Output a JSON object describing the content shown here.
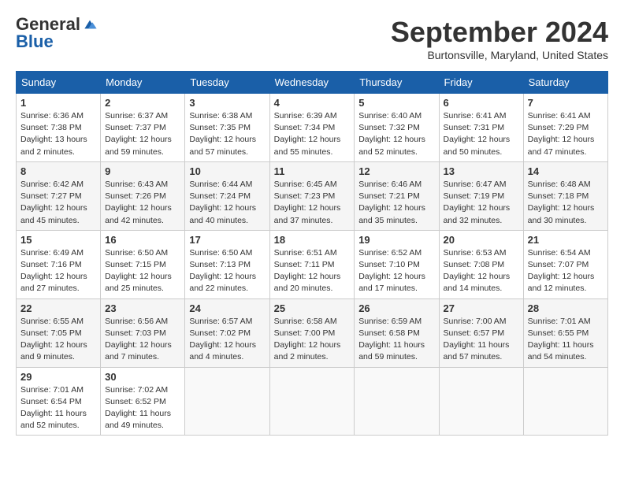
{
  "logo": {
    "text_general": "General",
    "text_blue": "Blue"
  },
  "title": "September 2024",
  "location": "Burtonsville, Maryland, United States",
  "weekdays": [
    "Sunday",
    "Monday",
    "Tuesday",
    "Wednesday",
    "Thursday",
    "Friday",
    "Saturday"
  ],
  "weeks": [
    [
      {
        "day": "1",
        "content": "Sunrise: 6:36 AM\nSunset: 7:38 PM\nDaylight: 13 hours\nand 2 minutes."
      },
      {
        "day": "2",
        "content": "Sunrise: 6:37 AM\nSunset: 7:37 PM\nDaylight: 12 hours\nand 59 minutes."
      },
      {
        "day": "3",
        "content": "Sunrise: 6:38 AM\nSunset: 7:35 PM\nDaylight: 12 hours\nand 57 minutes."
      },
      {
        "day": "4",
        "content": "Sunrise: 6:39 AM\nSunset: 7:34 PM\nDaylight: 12 hours\nand 55 minutes."
      },
      {
        "day": "5",
        "content": "Sunrise: 6:40 AM\nSunset: 7:32 PM\nDaylight: 12 hours\nand 52 minutes."
      },
      {
        "day": "6",
        "content": "Sunrise: 6:41 AM\nSunset: 7:31 PM\nDaylight: 12 hours\nand 50 minutes."
      },
      {
        "day": "7",
        "content": "Sunrise: 6:41 AM\nSunset: 7:29 PM\nDaylight: 12 hours\nand 47 minutes."
      }
    ],
    [
      {
        "day": "8",
        "content": "Sunrise: 6:42 AM\nSunset: 7:27 PM\nDaylight: 12 hours\nand 45 minutes."
      },
      {
        "day": "9",
        "content": "Sunrise: 6:43 AM\nSunset: 7:26 PM\nDaylight: 12 hours\nand 42 minutes."
      },
      {
        "day": "10",
        "content": "Sunrise: 6:44 AM\nSunset: 7:24 PM\nDaylight: 12 hours\nand 40 minutes."
      },
      {
        "day": "11",
        "content": "Sunrise: 6:45 AM\nSunset: 7:23 PM\nDaylight: 12 hours\nand 37 minutes."
      },
      {
        "day": "12",
        "content": "Sunrise: 6:46 AM\nSunset: 7:21 PM\nDaylight: 12 hours\nand 35 minutes."
      },
      {
        "day": "13",
        "content": "Sunrise: 6:47 AM\nSunset: 7:19 PM\nDaylight: 12 hours\nand 32 minutes."
      },
      {
        "day": "14",
        "content": "Sunrise: 6:48 AM\nSunset: 7:18 PM\nDaylight: 12 hours\nand 30 minutes."
      }
    ],
    [
      {
        "day": "15",
        "content": "Sunrise: 6:49 AM\nSunset: 7:16 PM\nDaylight: 12 hours\nand 27 minutes."
      },
      {
        "day": "16",
        "content": "Sunrise: 6:50 AM\nSunset: 7:15 PM\nDaylight: 12 hours\nand 25 minutes."
      },
      {
        "day": "17",
        "content": "Sunrise: 6:50 AM\nSunset: 7:13 PM\nDaylight: 12 hours\nand 22 minutes."
      },
      {
        "day": "18",
        "content": "Sunrise: 6:51 AM\nSunset: 7:11 PM\nDaylight: 12 hours\nand 20 minutes."
      },
      {
        "day": "19",
        "content": "Sunrise: 6:52 AM\nSunset: 7:10 PM\nDaylight: 12 hours\nand 17 minutes."
      },
      {
        "day": "20",
        "content": "Sunrise: 6:53 AM\nSunset: 7:08 PM\nDaylight: 12 hours\nand 14 minutes."
      },
      {
        "day": "21",
        "content": "Sunrise: 6:54 AM\nSunset: 7:07 PM\nDaylight: 12 hours\nand 12 minutes."
      }
    ],
    [
      {
        "day": "22",
        "content": "Sunrise: 6:55 AM\nSunset: 7:05 PM\nDaylight: 12 hours\nand 9 minutes."
      },
      {
        "day": "23",
        "content": "Sunrise: 6:56 AM\nSunset: 7:03 PM\nDaylight: 12 hours\nand 7 minutes."
      },
      {
        "day": "24",
        "content": "Sunrise: 6:57 AM\nSunset: 7:02 PM\nDaylight: 12 hours\nand 4 minutes."
      },
      {
        "day": "25",
        "content": "Sunrise: 6:58 AM\nSunset: 7:00 PM\nDaylight: 12 hours\nand 2 minutes."
      },
      {
        "day": "26",
        "content": "Sunrise: 6:59 AM\nSunset: 6:58 PM\nDaylight: 11 hours\nand 59 minutes."
      },
      {
        "day": "27",
        "content": "Sunrise: 7:00 AM\nSunset: 6:57 PM\nDaylight: 11 hours\nand 57 minutes."
      },
      {
        "day": "28",
        "content": "Sunrise: 7:01 AM\nSunset: 6:55 PM\nDaylight: 11 hours\nand 54 minutes."
      }
    ],
    [
      {
        "day": "29",
        "content": "Sunrise: 7:01 AM\nSunset: 6:54 PM\nDaylight: 11 hours\nand 52 minutes."
      },
      {
        "day": "30",
        "content": "Sunrise: 7:02 AM\nSunset: 6:52 PM\nDaylight: 11 hours\nand 49 minutes."
      },
      {
        "day": "",
        "content": ""
      },
      {
        "day": "",
        "content": ""
      },
      {
        "day": "",
        "content": ""
      },
      {
        "day": "",
        "content": ""
      },
      {
        "day": "",
        "content": ""
      }
    ]
  ]
}
